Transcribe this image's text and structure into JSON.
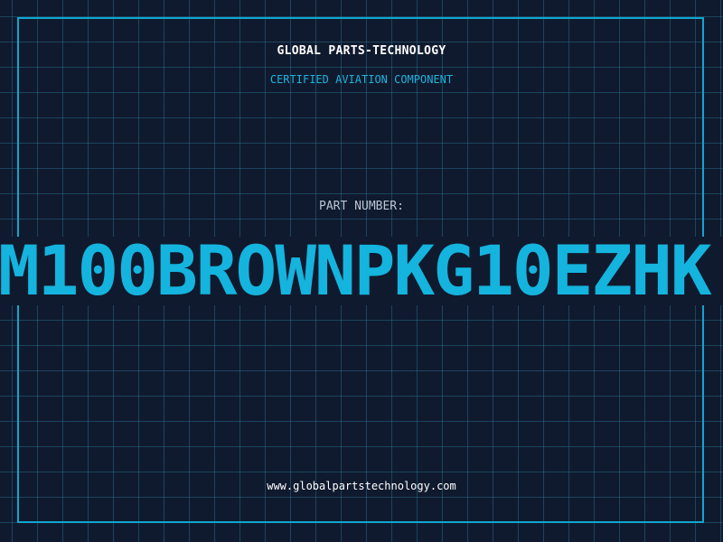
{
  "header": {
    "company_name": "GLOBAL PARTS-TECHNOLOGY",
    "subtitle": "CERTIFIED AVIATION COMPONENT"
  },
  "part": {
    "label": "PART NUMBER:",
    "number": "M100BROWNPKG10EZHK"
  },
  "footer": {
    "website": "www.globalpartstechnology.com"
  },
  "colors": {
    "background": "#101a2e",
    "grid": "#1f6a86",
    "accent": "#14b4de",
    "frame": "#10a6cf",
    "heading": "#ffffff",
    "label": "#b9c6d4"
  }
}
